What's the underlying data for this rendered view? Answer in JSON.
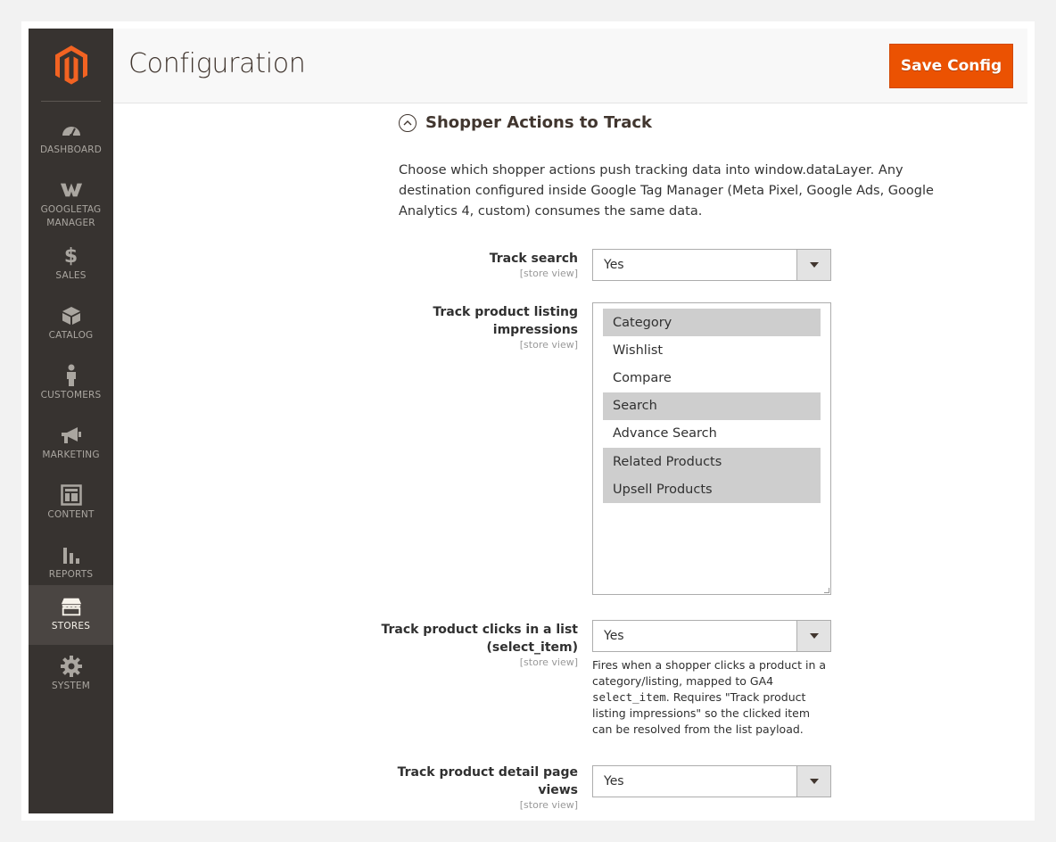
{
  "header": {
    "title": "Configuration",
    "save_label": "Save Config"
  },
  "sidebar": {
    "items": [
      {
        "label": "DASHBOARD",
        "icon": "dashboard-icon"
      },
      {
        "label": "GOOGLETAG",
        "label2": "MANAGER",
        "icon": "googletag-icon"
      },
      {
        "label": "SALES",
        "icon": "dollar-icon"
      },
      {
        "label": "CATALOG",
        "icon": "box-icon"
      },
      {
        "label": "CUSTOMERS",
        "icon": "person-icon"
      },
      {
        "label": "MARKETING",
        "icon": "megaphone-icon"
      },
      {
        "label": "CONTENT",
        "icon": "layout-icon"
      },
      {
        "label": "REPORTS",
        "icon": "bar-chart-icon"
      },
      {
        "label": "STORES",
        "icon": "store-icon",
        "active": true
      },
      {
        "label": "SYSTEM",
        "icon": "gear-icon"
      }
    ]
  },
  "section": {
    "title": "Shopper Actions to Track",
    "description": "Choose which shopper actions push tracking data into window.dataLayer. Any destination configured inside Google Tag Manager (Meta Pixel, Google Ads, Google Analytics 4, custom) consumes the same data."
  },
  "fields": {
    "scope": "[store view]",
    "track_search": {
      "label": "Track search",
      "value": "Yes"
    },
    "listing": {
      "label_line1": "Track product listing",
      "label_line2": "impressions",
      "options": [
        {
          "label": "Category",
          "selected": true
        },
        {
          "label": "Wishlist",
          "selected": false
        },
        {
          "label": "Compare",
          "selected": false
        },
        {
          "label": "Search",
          "selected": true
        },
        {
          "label": "Advance Search",
          "selected": false
        },
        {
          "label": "Related Products",
          "selected": true
        },
        {
          "label": "Upsell Products",
          "selected": true
        }
      ]
    },
    "clicks": {
      "label_line1": "Track product clicks in a list",
      "label_line2": "(select_item)",
      "value": "Yes",
      "note_before": "Fires when a shopper clicks a product in a category/listing, mapped to GA4 ",
      "note_code": "select_item",
      "note_after": ". Requires \"Track product listing impressions\" so the clicked item can be resolved from the list payload."
    },
    "detail": {
      "label_line1": "Track product detail page",
      "label_line2": "views",
      "value": "Yes"
    }
  },
  "colors": {
    "accent": "#eb5202",
    "sidebar_bg": "#373330",
    "sidebar_active": "#4a4542"
  }
}
